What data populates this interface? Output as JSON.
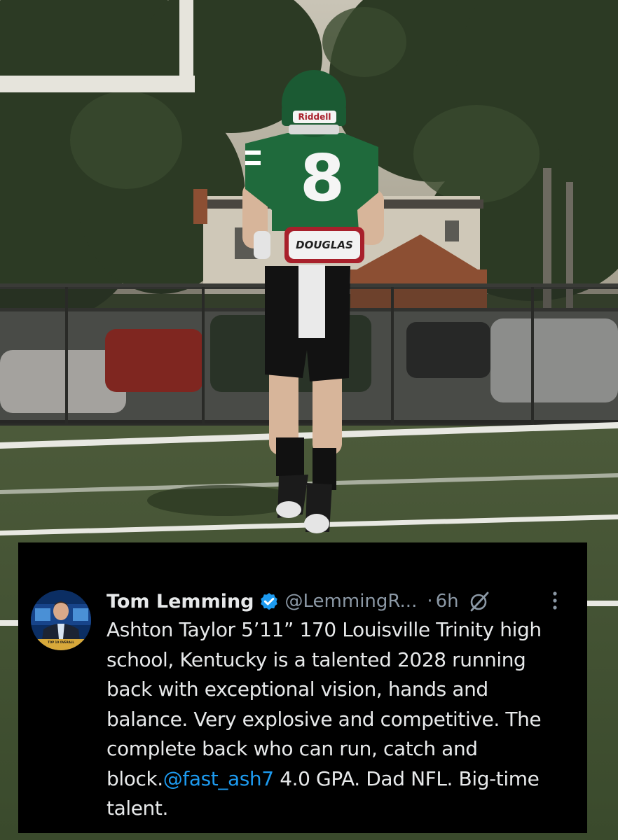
{
  "photo": {
    "helmet_brand": "Riddell",
    "jersey_number": "8",
    "belt_label": "DOUGLAS"
  },
  "tweet": {
    "author_name": "Tom Lemming",
    "handle": "@LemmingR...",
    "separator": "·",
    "time": "6h",
    "text_lines": [
      "Ashton Taylor 5’11” 170 Louisville Trinity high",
      "school, Kentucky is a talented 2028 running",
      "back with exceptional vision, hands and",
      "balance. Very explosive and competitive. The",
      "complete back who can run, catch and"
    ],
    "last_line_prefix": "block.",
    "mention": "@fast_ash7",
    "last_line_suffix": " 4.0 GPA. Dad NFL. Big-time",
    "final_line": "talent.",
    "avatar_caption": "TOP 10 OVERALL"
  },
  "colors": {
    "jersey": "#1f6a3c",
    "link": "#1d9bf0",
    "verified": "#1d9bf0",
    "muted_text": "#8b98a5",
    "card_bg": "#000000"
  },
  "icons": [
    "verified-badge-icon",
    "grok-icon",
    "more-options-icon"
  ]
}
